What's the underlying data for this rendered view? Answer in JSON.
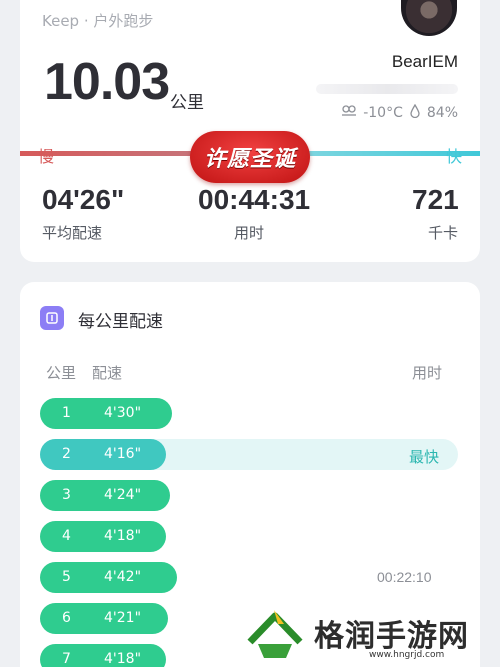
{
  "summary": {
    "source": "Keep · 户外跑步",
    "username": "BearIEM",
    "weather": {
      "temperature": "-10°C",
      "humidity": "84%",
      "weather_icon": "haze-icon",
      "humidity_icon": "droplet-icon"
    },
    "distance": "10.03",
    "distance_unit": "公里",
    "slow_label": "慢",
    "fast_label": "快",
    "badge_text": "许愿圣诞",
    "stats": [
      {
        "value": "04'26\"",
        "label": "平均配速"
      },
      {
        "value": "00:44:31",
        "label": "用时"
      },
      {
        "value": "721",
        "label": "千卡"
      }
    ]
  },
  "pace_section": {
    "title": "每公里配速",
    "columns": {
      "km": "公里",
      "pace": "配速",
      "time": "用时"
    },
    "fastest_label": "最快",
    "rows": [
      {
        "km": "1",
        "pace": "4'30\"",
        "split_time": "",
        "fastest": false
      },
      {
        "km": "2",
        "pace": "4'16\"",
        "split_time": "",
        "fastest": true
      },
      {
        "km": "3",
        "pace": "4'24\"",
        "split_time": "",
        "fastest": false
      },
      {
        "km": "4",
        "pace": "4'18\"",
        "split_time": "",
        "fastest": false
      },
      {
        "km": "5",
        "pace": "4'42\"",
        "split_time": "00:22:10",
        "fastest": false
      },
      {
        "km": "6",
        "pace": "4'21\"",
        "split_time": "",
        "fastest": false
      },
      {
        "km": "7",
        "pace": "4'18\"",
        "split_time": "",
        "fastest": false
      }
    ]
  },
  "watermark": {
    "text": "格润手游网",
    "url": "www.hngrjd.com"
  },
  "colors": {
    "slow": "#d65a5a",
    "fast": "#40c8d8",
    "bar": "#2fcc8f",
    "fastest_bar": "#40c8c0",
    "badge": "#d81e1e"
  }
}
